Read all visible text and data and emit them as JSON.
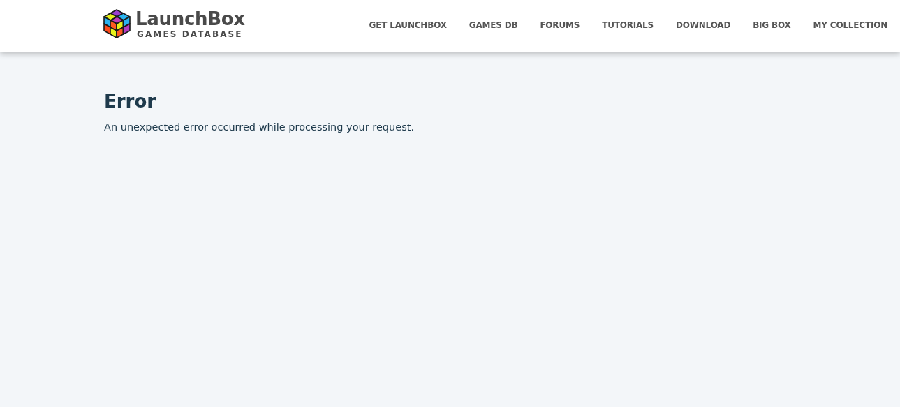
{
  "header": {
    "brand": "LaunchBox",
    "subtitle": "GAMES DATABASE",
    "nav": [
      {
        "label": "GET LAUNCHBOX"
      },
      {
        "label": "GAMES DB"
      },
      {
        "label": "FORUMS"
      },
      {
        "label": "TUTORIALS"
      },
      {
        "label": "DOWNLOAD"
      },
      {
        "label": "BIG BOX"
      },
      {
        "label": "MY COLLECTION"
      }
    ]
  },
  "content": {
    "heading": "Error",
    "message": "An unexpected error occurred while processing your request."
  }
}
